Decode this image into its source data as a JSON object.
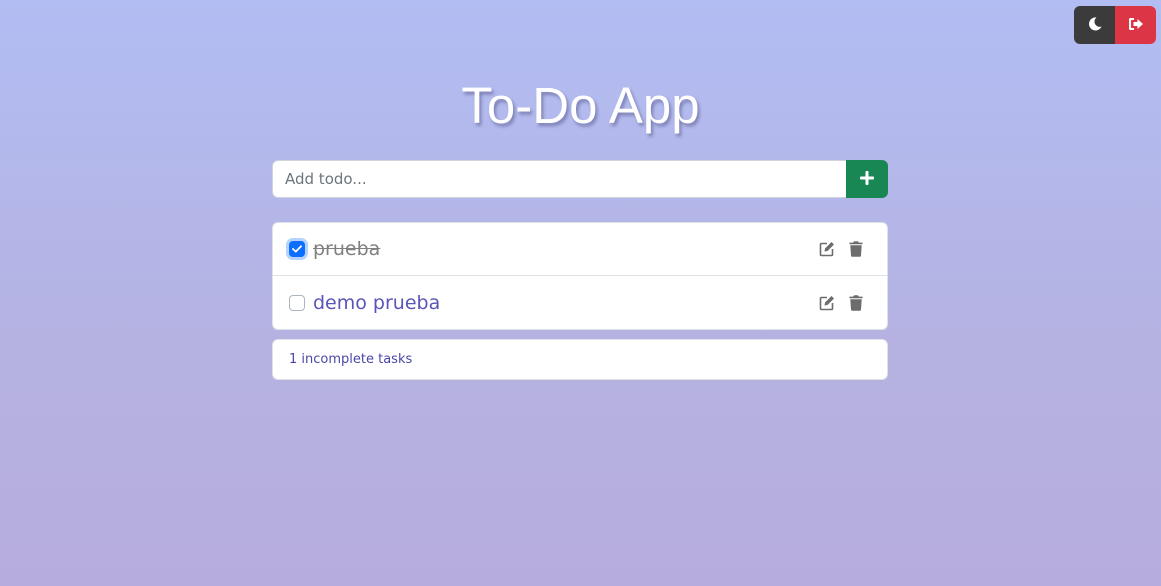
{
  "header": {
    "title": "To-Do App"
  },
  "controls": {
    "dark_mode_icon": "moon-icon",
    "logout_icon": "sign-out-icon"
  },
  "add_form": {
    "placeholder": "Add todo...",
    "value": "",
    "add_icon": "plus-icon"
  },
  "todos": [
    {
      "text": "prueba",
      "completed": true
    },
    {
      "text": "demo prueba",
      "completed": false
    }
  ],
  "footer": {
    "status": "1 incomplete tasks"
  },
  "colors": {
    "add_button": "#198754",
    "logout_button": "#dc3545",
    "dark_button": "#3b3b3c",
    "checkbox_checked": "#0d6efd",
    "todo_text": "#5a55b8"
  }
}
